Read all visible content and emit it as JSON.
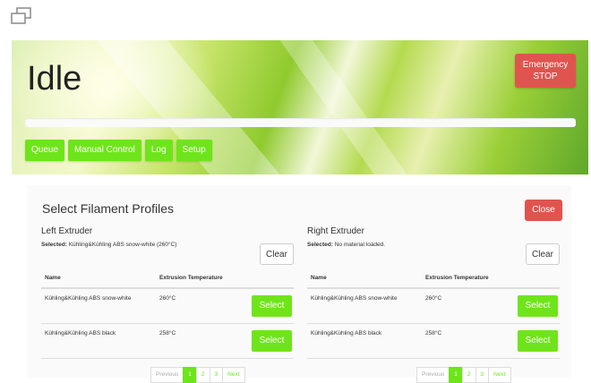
{
  "window": {
    "icon": "restore-window-icon"
  },
  "header": {
    "status": "Idle",
    "emergency_stop": "Emergency STOP",
    "progress": 0,
    "nav": [
      "Queue",
      "Manual Control",
      "Log",
      "Setup"
    ],
    "colors": {
      "accent": "#6ee51a",
      "danger": "#e0544f"
    }
  },
  "panel": {
    "title": "Select Filament Profiles",
    "close_label": "Close",
    "left": {
      "title": "Left Extruder",
      "selected_label": "Selected:",
      "selected_value": "Kühling&Kühling ABS snow-white (260°C)",
      "clear_label": "Clear",
      "columns": [
        "Name",
        "Extrusion Temperature"
      ],
      "rows": [
        {
          "name": "Kühling&Kühling ABS snow-white",
          "temp": "260°C",
          "action": "Select"
        },
        {
          "name": "Kühling&Kühling ABS black",
          "temp": "258°C",
          "action": "Select"
        }
      ],
      "pagination": {
        "previous": "Previous",
        "pages": [
          "1",
          "2",
          "3"
        ],
        "active": "1",
        "next": "Next"
      }
    },
    "right": {
      "title": "Right Extruder",
      "selected_label": "Selected:",
      "selected_value": "No material loaded.",
      "clear_label": "Clear",
      "columns": [
        "Name",
        "Extrusion Temperature"
      ],
      "rows": [
        {
          "name": "Kühling&Kühling ABS snow-white",
          "temp": "260°C",
          "action": "Select"
        },
        {
          "name": "Kühling&Kühling ABS black",
          "temp": "258°C",
          "action": "Select"
        }
      ],
      "pagination": {
        "previous": "Previous",
        "pages": [
          "1",
          "2",
          "3"
        ],
        "active": "1",
        "next": "Next"
      }
    }
  }
}
